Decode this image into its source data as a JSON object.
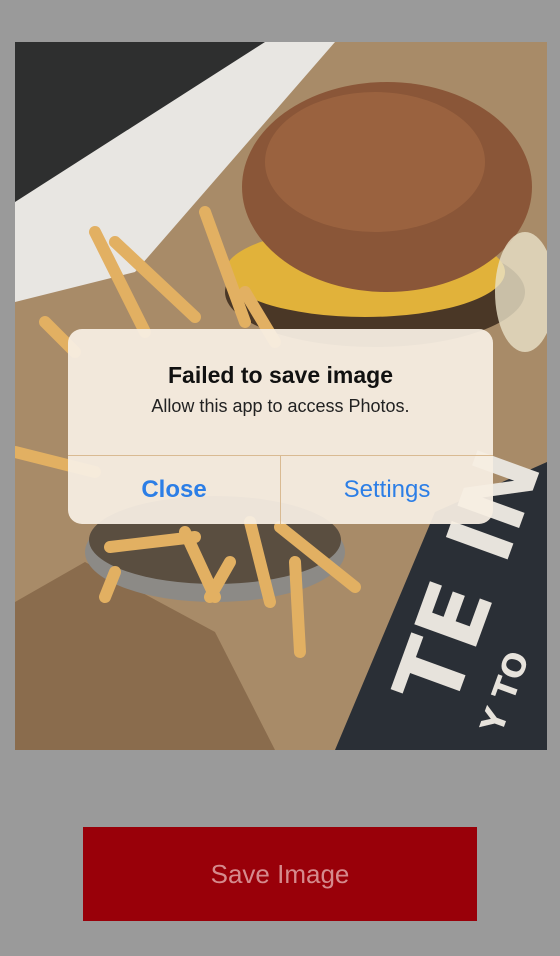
{
  "photo": {
    "description_icon": "burger-and-fries-photo",
    "overlay_text": "TE IN",
    "overlay_text_2": "Y TO"
  },
  "alert": {
    "title": "Failed to save image",
    "message": "Allow this app to access Photos.",
    "close_label": "Close",
    "settings_label": "Settings"
  },
  "save_button": {
    "label": "Save Image"
  },
  "colors": {
    "background": "#9a9a9a",
    "save_button": "#990009",
    "alert_action": "#2c7ee6"
  }
}
